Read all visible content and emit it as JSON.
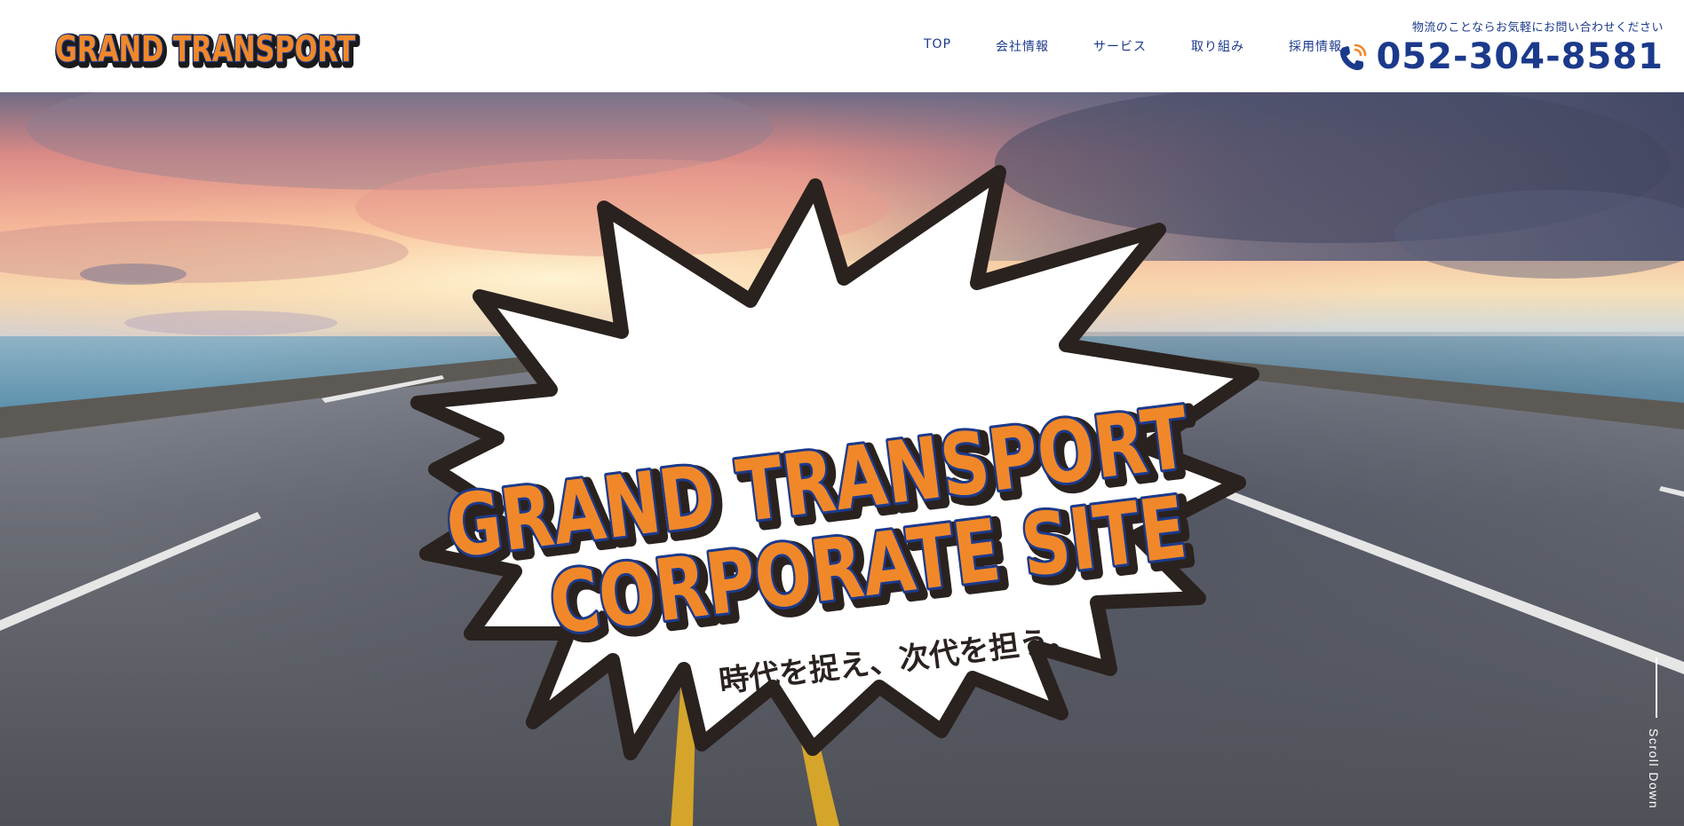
{
  "brand": {
    "logo_text": "GRAND TRANSPORT",
    "orange": "#f0882a",
    "navy": "#1c3a8c",
    "black": "#1a1a1a"
  },
  "nav": {
    "items": [
      {
        "label": "TOP"
      },
      {
        "label": "会社情報"
      },
      {
        "label": "サービス"
      },
      {
        "label": "取り組み"
      },
      {
        "label": "採用情報"
      }
    ]
  },
  "contact": {
    "note": "物流のことならお気軽にお問い合わせください",
    "phone": "052-304-8581",
    "icon": "phone-icon"
  },
  "hero": {
    "headline_line1": "GRAND TRANSPORT",
    "headline_line2": "CORPORATE SITE",
    "tagline": "時代を捉え、次代を担う。",
    "scroll_label": "Scroll Down"
  }
}
